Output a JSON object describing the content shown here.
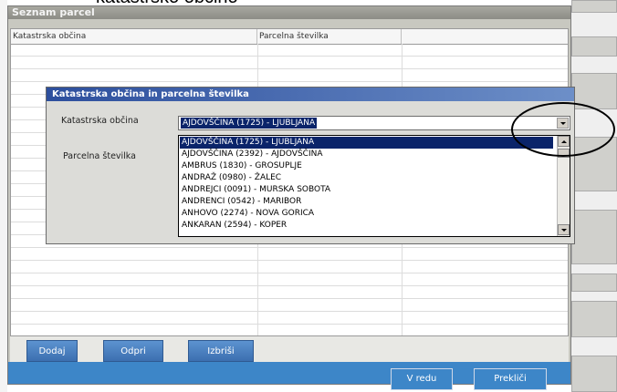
{
  "crop_title": "katastrsko občino",
  "window": {
    "title": "Seznam parcel",
    "columns": [
      "Katastrska občina",
      "Parcelna številka"
    ],
    "buttons": {
      "add": "Dodaj",
      "open": "Odpri",
      "delete": "Izbriši"
    },
    "footer": {
      "ok": "V redu",
      "cancel": "Prekliči"
    }
  },
  "dialog": {
    "title": "Katastrska občina in parcelna številka",
    "field_ko_label": "Katastrska občina",
    "field_parcel_label": "Parcelna številka",
    "selected_value": "AJDOVŠČINA (1725) - LJUBLJANA",
    "options": [
      "AJDOVŠČINA (1725) - LJUBLJANA",
      "AJDOVŠČINA (2392) - AJDOVŠČINA",
      "AMBRUS (1830) - GROSUPLJE",
      "ANDRAŽ (0980) - ŽALEC",
      "ANDREJCI (0091) - MURSKA SOBOTA",
      "ANDRENCI (0542) - MARIBOR",
      "ANHOVO (2274) - NOVA GORICA",
      "ANKARAN (2594) - KOPER"
    ],
    "selected_index": 0
  },
  "colors": {
    "titlebar": "#2d4f9d",
    "selection": "#0a246a",
    "button": "#3d86c8"
  }
}
